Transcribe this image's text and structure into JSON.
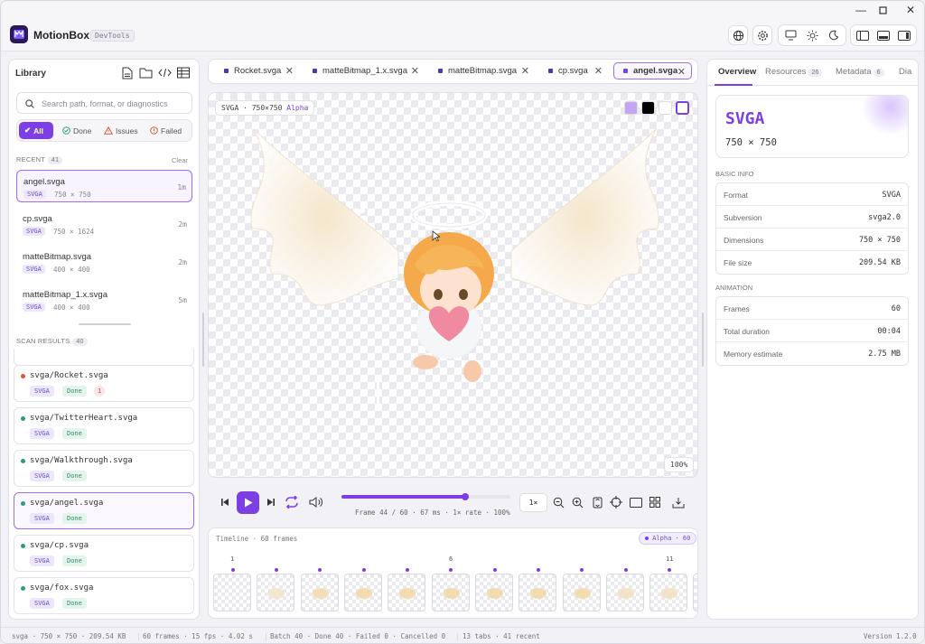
{
  "app": {
    "name": "MotionBox",
    "tag": "DevTools"
  },
  "library": {
    "title": "Library",
    "search_placeholder": "Search path, format, or diagnostics",
    "filters": [
      "All",
      "Done",
      "Issues",
      "Failed"
    ],
    "recent_label": "RECENT",
    "recent_count": "41",
    "clear_label": "Clear",
    "recent": [
      {
        "name": "angel.svga",
        "type": "SVGA",
        "dims": "750 × 750",
        "time": "1m"
      },
      {
        "name": "cp.svga",
        "type": "SVGA",
        "dims": "750 × 1624",
        "time": "2m"
      },
      {
        "name": "matteBitmap.svga",
        "type": "SVGA",
        "dims": "400 × 400",
        "time": "2m"
      },
      {
        "name": "matteBitmap_1.x.svga",
        "type": "SVGA",
        "dims": "400 × 400",
        "time": "5m"
      }
    ],
    "scan_label": "SCAN RESULTS",
    "scan_count": "40",
    "scan": [
      {
        "name": "svga/Rocket.svga",
        "type": "SVGA",
        "status": "Done",
        "issues": "1"
      },
      {
        "name": "svga/TwitterHeart.svga",
        "type": "SVGA",
        "status": "Done"
      },
      {
        "name": "svga/Walkthrough.svga",
        "type": "SVGA",
        "status": "Done"
      },
      {
        "name": "svga/angel.svga",
        "type": "SVGA",
        "status": "Done"
      },
      {
        "name": "svga/cp.svga",
        "type": "SVGA",
        "status": "Done"
      },
      {
        "name": "svga/fox.svga",
        "type": "SVGA",
        "status": "Done"
      }
    ]
  },
  "tabs": [
    "Rocket.svga",
    "matteBitmap_1.x.svga",
    "matteBitmap.svga",
    "cp.svga",
    "angel.svga"
  ],
  "canvas": {
    "info": "SVGA · 750×750",
    "alpha": "Alpha",
    "zoom": "100%"
  },
  "player": {
    "speed": "1×",
    "progress": 0.733,
    "readout": "Frame 44 / 60 · 67 ms · 1× rate · 100%"
  },
  "timeline": {
    "title": "Timeline · 60 frames",
    "alpha_badge": "Alpha · 60",
    "markers": [
      "1",
      "6",
      "11"
    ]
  },
  "inspector": {
    "tabs": [
      {
        "label": "Overview"
      },
      {
        "label": "Resources",
        "count": "26"
      },
      {
        "label": "Metadata",
        "count": "6"
      },
      {
        "label": "Dia"
      }
    ],
    "format_big": "SVGA",
    "dims_big": "750 × 750",
    "basic_label": "BASIC INFO",
    "basic": [
      {
        "k": "Format",
        "v": "SVGA"
      },
      {
        "k": "Subversion",
        "v": "svga2.0"
      },
      {
        "k": "Dimensions",
        "v": "750 × 750"
      },
      {
        "k": "File size",
        "v": "209.54 KB"
      }
    ],
    "anim_label": "ANIMATION",
    "anim": [
      {
        "k": "Frames",
        "v": "60"
      },
      {
        "k": "Total duration",
        "v": "00:04"
      },
      {
        "k": "Memory estimate",
        "v": "2.75 MB"
      }
    ]
  },
  "status": {
    "file": "svga · 750 × 750 · 209.54 KB",
    "frames": "60 frames · 15 fps · 4.02 s",
    "batch": "Batch 40 · Done 40 · Failed 0 · Cancelled 0",
    "tabs": "13 tabs · 41 recent",
    "version": "Version 1.2.0"
  },
  "colors": {
    "accent": "#7b3fe4",
    "done": "#2f9a76",
    "issue": "#d65a3a"
  }
}
